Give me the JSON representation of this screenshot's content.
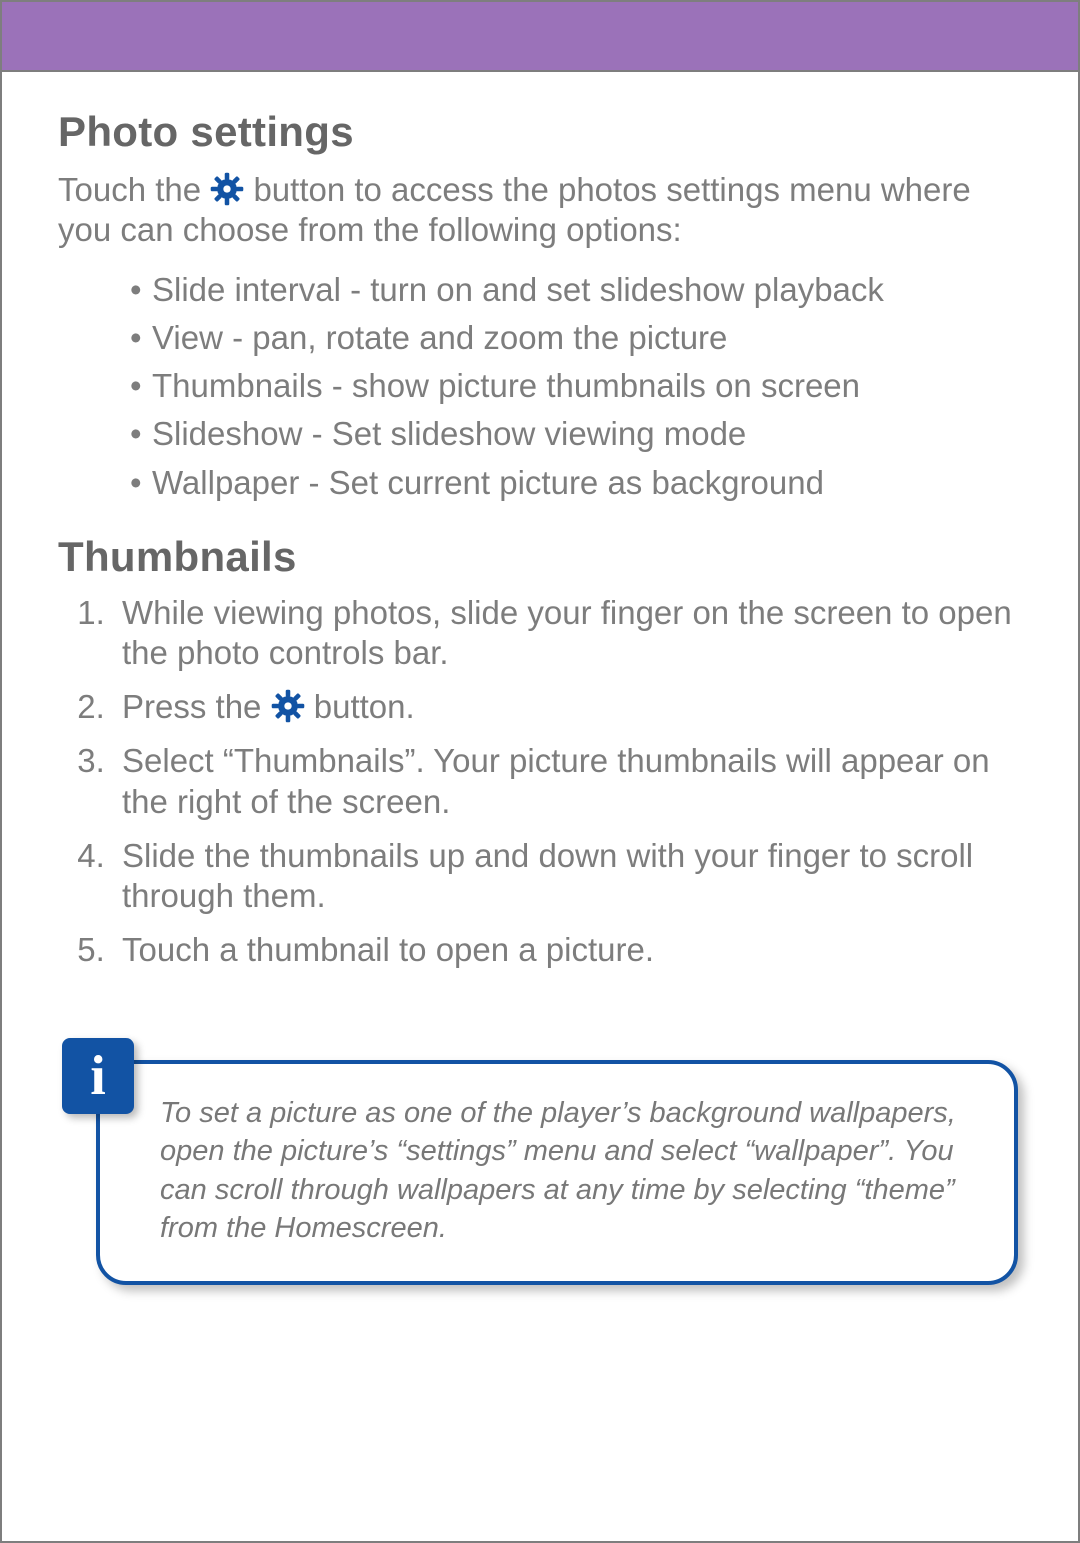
{
  "section1": {
    "heading": "Photo settings",
    "intro_before": "Touch the ",
    "intro_after": " button to access the photos settings menu where you can choose from the following options:",
    "bullets": [
      "Slide interval - turn on and set slideshow playback",
      "View - pan, rotate and zoom the picture",
      "Thumbnails - show picture thumbnails on screen",
      "Slideshow - Set slideshow viewing mode",
      "Wallpaper - Set current picture as background"
    ]
  },
  "section2": {
    "heading": "Thumbnails",
    "steps": [
      "While viewing photos, slide your finger on the screen to open the photo controls bar.",
      {
        "before": "Press the ",
        "after": " button."
      },
      "Select “Thumbnails”.  Your picture thumbnails will appear on the right of the screen.",
      "Slide the thumbnails up and down with your finger to scroll through them.",
      "Touch a thumbnail to open a picture."
    ]
  },
  "info": {
    "badge": "i",
    "text": "To set a picture as one of the player’s background wallpapers, open the picture’s “settings” menu and select “wallpaper”. You can scroll through wallpapers at any time by selecting “theme” from the Homescreen."
  },
  "icons": {
    "gear_color": "#1253a4"
  }
}
